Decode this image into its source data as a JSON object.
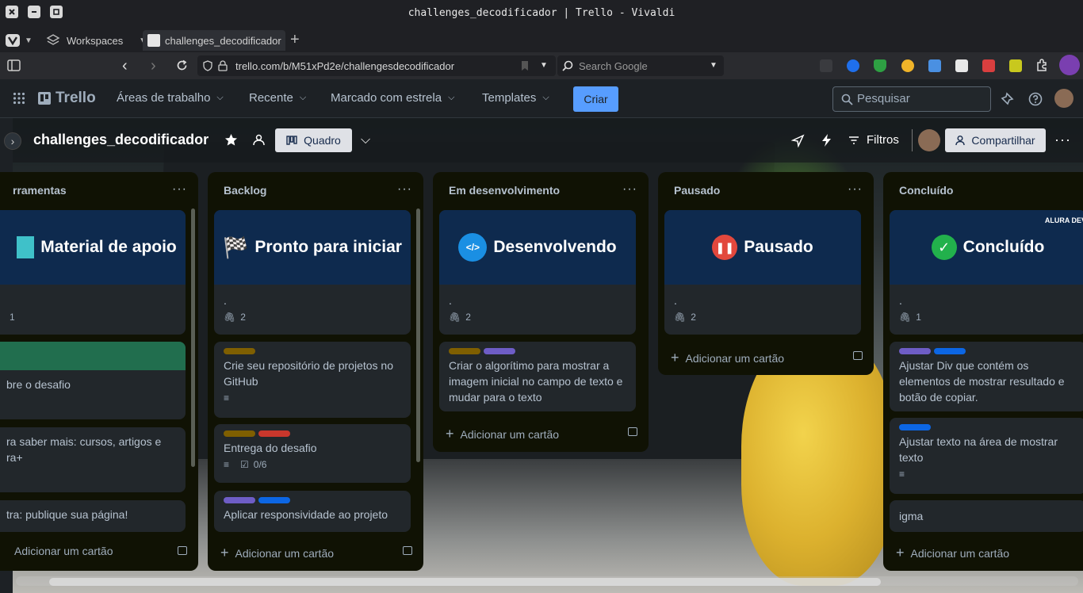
{
  "window": {
    "title": "challenges_decodificador | Trello - Vivaldi"
  },
  "tabs": {
    "workspaces": "Workspaces",
    "active_tab": "challenges_decodificador | T"
  },
  "address": {
    "url": "trello.com/b/M51xPd2e/challengesdecodificador",
    "search_placeholder": "Search Google"
  },
  "header": {
    "logo": "Trello",
    "nav": [
      "Áreas de trabalho",
      "Recente",
      "Marcado com estrela",
      "Templates"
    ],
    "create": "Criar",
    "search_placeholder": "Pesquisar"
  },
  "board": {
    "title": "challenges_decodificador",
    "view": "Quadro",
    "filters": "Filtros",
    "share": "Compartilhar"
  },
  "lists": [
    {
      "title": "rramentas",
      "add": "Adicionar um cartão",
      "cards": [
        {
          "cover": "Material de apoio",
          "text": "",
          "attachments": "1"
        },
        {
          "text": "bre o desafio"
        },
        {
          "text": "ra saber mais: cursos, artigos e ra+"
        },
        {
          "text": "tra: publique sua página!"
        }
      ]
    },
    {
      "title": "Backlog",
      "add": "Adicionar um cartão",
      "cards": [
        {
          "cover": "Pronto para iniciar",
          "text": ".",
          "attachments": "2"
        },
        {
          "text": "Crie seu repositório de projetos no GitHub"
        },
        {
          "text": "Entrega do desafio",
          "checklist": "0/6"
        },
        {
          "text": "Aplicar responsividade ao projeto"
        }
      ]
    },
    {
      "title": "Em desenvolvimento",
      "add": "Adicionar um cartão",
      "cards": [
        {
          "cover": "Desenvolvendo",
          "text": ".",
          "attachments": "2"
        },
        {
          "text": "Criar o algorítimo para mostrar a imagem inicial no campo de texto e mudar para o texto"
        }
      ]
    },
    {
      "title": "Pausado",
      "add": "Adicionar um cartão",
      "cards": [
        {
          "cover": "Pausado",
          "text": ".",
          "attachments": "2"
        }
      ]
    },
    {
      "title": "Concluído",
      "add": "Adicionar um cartão",
      "cards": [
        {
          "cover": "Concluído",
          "cover_badge": "ALURA DEV",
          "text": ".",
          "attachments": "1"
        },
        {
          "text": "Ajustar Div que contém os elementos de mostrar resultado e botão de copiar."
        },
        {
          "text": "Ajustar texto na área de mostrar texto"
        },
        {
          "text": "igma"
        }
      ]
    }
  ],
  "colors": {
    "label_yellow": "#7f5f01",
    "label_purple": "#6e5dc6",
    "label_blue": "#0c66e4",
    "label_red": "#c9372c",
    "label_green": "#216e4e",
    "cover_bg": "#0e2a4e",
    "accent": "#579dff"
  }
}
